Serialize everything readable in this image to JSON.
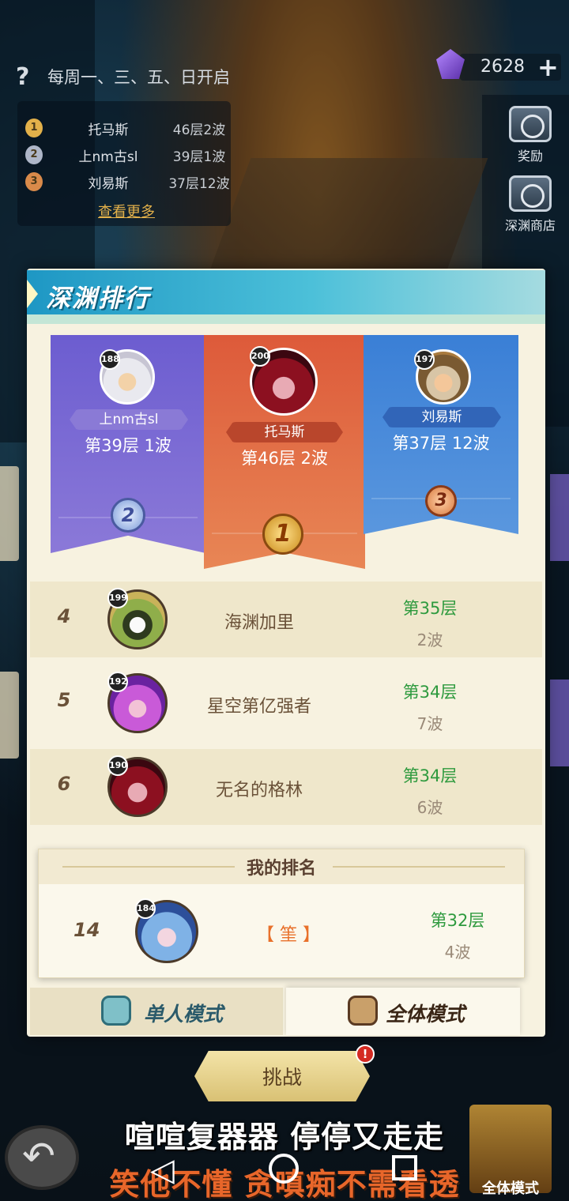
{
  "top": {
    "help_icon": "?",
    "schedule": "每周一、三、五、日开启",
    "currency": "2628",
    "plus": "+"
  },
  "mini_board": {
    "rows": [
      {
        "medal": "1",
        "name": "托马斯",
        "score": "46层2波",
        "color": "#e3b14a"
      },
      {
        "medal": "2",
        "name": "上nm古sl",
        "score": "39层1波",
        "color": "#aeb6c8"
      },
      {
        "medal": "3",
        "name": "刘易斯",
        "score": "37层12波",
        "color": "#d98a4a"
      }
    ],
    "more": "查看更多"
  },
  "side": {
    "reward": "奖励",
    "shop": "深渊商店"
  },
  "panel": {
    "title": "深渊排行"
  },
  "podium": {
    "second": {
      "level": "188",
      "name": "上nm古sl",
      "score": "第39层 1波",
      "medal": "2"
    },
    "first": {
      "level": "200",
      "name": "托马斯",
      "score": "第46层 2波",
      "medal": "1"
    },
    "third": {
      "level": "197",
      "name": "刘易斯",
      "score": "第37层 12波",
      "medal": "3"
    }
  },
  "list": [
    {
      "rank": "4",
      "level": "199",
      "name": "海渊加里",
      "floor": "第35层",
      "wave": "2波"
    },
    {
      "rank": "5",
      "level": "192",
      "name": "星空第亿强者",
      "floor": "第34层",
      "wave": "7波"
    },
    {
      "rank": "6",
      "level": "190",
      "name": "无名的格林",
      "floor": "第34层",
      "wave": "6波"
    }
  ],
  "my_rank": {
    "title": "我的排名",
    "rank": "14",
    "level": "184",
    "name": "【 筀 】",
    "floor": "第32层",
    "wave": "4波"
  },
  "tabs": {
    "single": "单人模式",
    "all": "全体模式"
  },
  "challenge": {
    "label": "挑战",
    "notify": "!"
  },
  "subtitles": {
    "line1": "喧喧复器器 停停又走走",
    "line2": "笑他不懂 贪嗔痴不需看透"
  },
  "bottom_right_label": "全体模式",
  "nav": {
    "back": "◁"
  },
  "colors": {
    "accent_header": "#1e97c4",
    "rank1": "#dd5a3a",
    "rank2": "#6c5dd0",
    "rank3": "#3a7fd6",
    "floor_green": "#2e9a3e",
    "my_name_orange": "#e8702a"
  }
}
